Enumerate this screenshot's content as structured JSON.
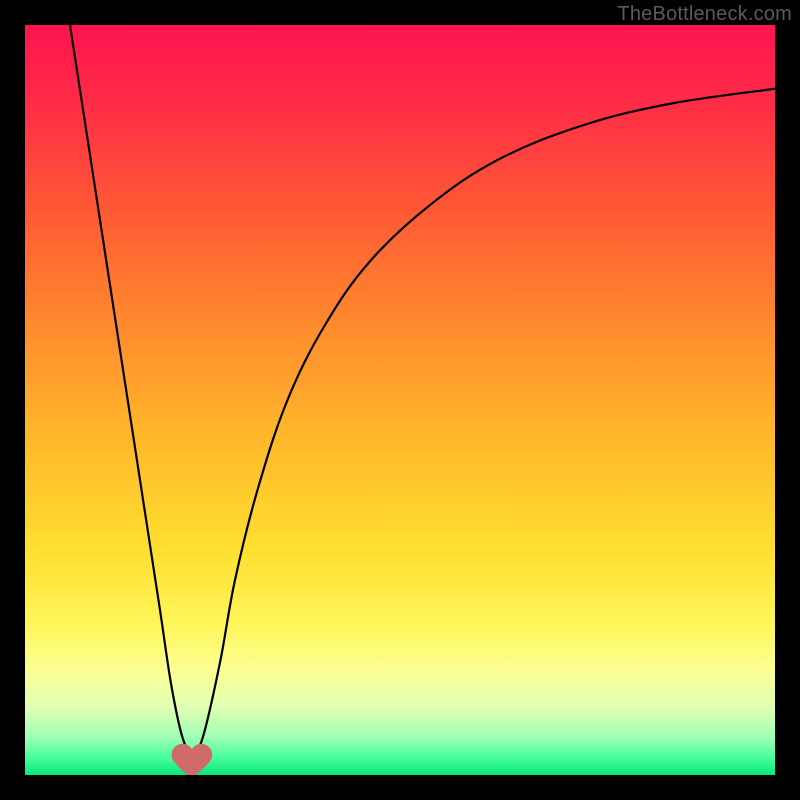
{
  "watermark": "TheBottleneck.com",
  "gradient_stops": [
    {
      "offset": 0.0,
      "color": "#ff1450"
    },
    {
      "offset": 0.1,
      "color": "#ff2b47"
    },
    {
      "offset": 0.25,
      "color": "#ff5a34"
    },
    {
      "offset": 0.4,
      "color": "#ff8a2e"
    },
    {
      "offset": 0.55,
      "color": "#ffb82a"
    },
    {
      "offset": 0.7,
      "color": "#ffdf30"
    },
    {
      "offset": 0.8,
      "color": "#fff65a"
    },
    {
      "offset": 0.86,
      "color": "#fcff93"
    },
    {
      "offset": 0.91,
      "color": "#e0ffb2"
    },
    {
      "offset": 0.95,
      "color": "#9dffb3"
    },
    {
      "offset": 0.975,
      "color": "#4dff9d"
    },
    {
      "offset": 1.0,
      "color": "#08e879"
    }
  ],
  "curve_style": {
    "stroke": "#000000",
    "stroke_width": 2.2
  },
  "marker_style": {
    "color": "#cf6b6b",
    "radius": 11
  },
  "chart_data": {
    "type": "line",
    "title": "",
    "xlabel": "",
    "ylabel": "",
    "xlim": [
      0,
      100
    ],
    "ylim": [
      0,
      100
    ],
    "note": "x and y are percentages of the plot area; y=0 is bottom (green / good), y=100 is top (red / bad). Curve is visually estimated from pixels.",
    "series": [
      {
        "name": "bottleneck-curve",
        "x": [
          6,
          8,
          10,
          12,
          14,
          16,
          18,
          19.5,
          21,
          22.3,
          23.7,
          26,
          28,
          31,
          35,
          40,
          46,
          54,
          63,
          74,
          86,
          100
        ],
        "y": [
          100,
          87,
          74,
          61,
          48,
          35,
          22,
          12,
          5,
          3,
          5,
          15,
          26,
          38,
          50,
          60,
          68.5,
          76,
          82,
          86.5,
          89.5,
          91.5
        ]
      }
    ],
    "markers": [
      {
        "name": "valley-left",
        "x": 21.0,
        "y": 2.7
      },
      {
        "name": "valley-right",
        "x": 23.5,
        "y": 2.7
      },
      {
        "name": "valley-bottom",
        "x": 22.2,
        "y": 1.4
      }
    ]
  }
}
